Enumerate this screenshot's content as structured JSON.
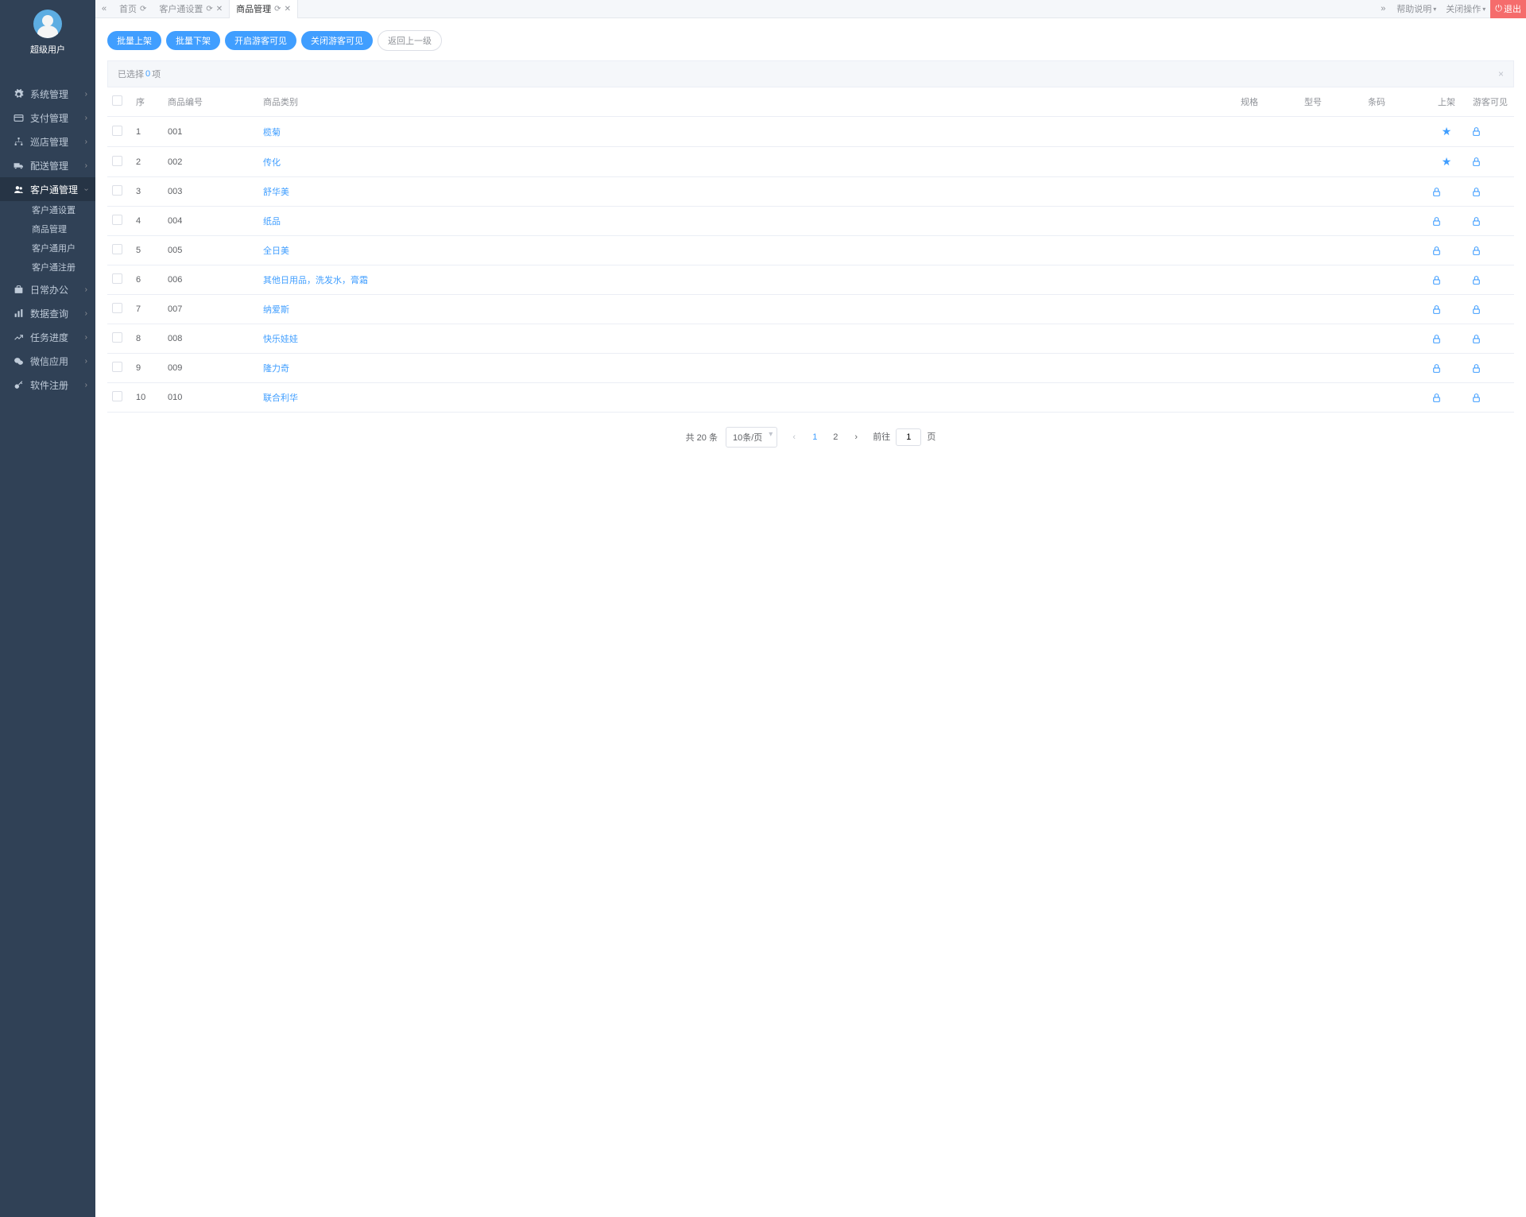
{
  "user": {
    "name": "超级用户"
  },
  "sidebar": {
    "items": [
      {
        "label": "系统管理"
      },
      {
        "label": "支付管理"
      },
      {
        "label": "巡店管理"
      },
      {
        "label": "配送管理"
      },
      {
        "label": "客户通管理",
        "active": true,
        "children": [
          {
            "label": "客户通设置"
          },
          {
            "label": "商品管理"
          },
          {
            "label": "客户通用户"
          },
          {
            "label": "客户通注册"
          }
        ]
      },
      {
        "label": "日常办公"
      },
      {
        "label": "数据查询"
      },
      {
        "label": "任务进度"
      },
      {
        "label": "微信应用"
      },
      {
        "label": "软件注册"
      }
    ]
  },
  "tabs": {
    "items": [
      {
        "label": "首页"
      },
      {
        "label": "客户通设置"
      },
      {
        "label": "商品管理",
        "active": true
      }
    ],
    "help": "帮助说明",
    "closeOps": "关闭操作",
    "exit": "退出"
  },
  "actions": {
    "batchOn": "批量上架",
    "batchOff": "批量下架",
    "openGuest": "开启游客可见",
    "closeGuest": "关闭游客可见",
    "back": "返回上一级"
  },
  "selectedBar": {
    "prefix": "已选择",
    "count": "0",
    "suffix": "项"
  },
  "table": {
    "headers": {
      "seq": "序",
      "code": "商品编号",
      "category": "商品类别",
      "spec": "规格",
      "model": "型号",
      "barcode": "条码",
      "onShelf": "上架",
      "guest": "游客可见"
    },
    "rows": [
      {
        "seq": "1",
        "code": "001",
        "category": "榄菊",
        "onShelf": "star",
        "guest": "lock"
      },
      {
        "seq": "2",
        "code": "002",
        "category": "传化",
        "onShelf": "star",
        "guest": "lock"
      },
      {
        "seq": "3",
        "code": "003",
        "category": "舒华美",
        "onShelf": "lock",
        "guest": "lock"
      },
      {
        "seq": "4",
        "code": "004",
        "category": "纸品",
        "onShelf": "lock",
        "guest": "lock"
      },
      {
        "seq": "5",
        "code": "005",
        "category": "全日美",
        "onShelf": "lock",
        "guest": "lock"
      },
      {
        "seq": "6",
        "code": "006",
        "category": "其他日用品，洗发水，膏霜",
        "onShelf": "lock",
        "guest": "lock"
      },
      {
        "seq": "7",
        "code": "007",
        "category": "纳爱斯",
        "onShelf": "lock",
        "guest": "lock"
      },
      {
        "seq": "8",
        "code": "008",
        "category": "快乐娃娃",
        "onShelf": "lock",
        "guest": "lock"
      },
      {
        "seq": "9",
        "code": "009",
        "category": "隆力奇",
        "onShelf": "lock",
        "guest": "lock"
      },
      {
        "seq": "10",
        "code": "010",
        "category": "联合利华",
        "onShelf": "lock",
        "guest": "lock"
      }
    ]
  },
  "pagination": {
    "total": "共 20 条",
    "perPage": "10条/页",
    "pages": [
      "1",
      "2"
    ],
    "current": "1",
    "gotoPrefix": "前往",
    "gotoSuffix": "页",
    "gotoValue": "1"
  }
}
